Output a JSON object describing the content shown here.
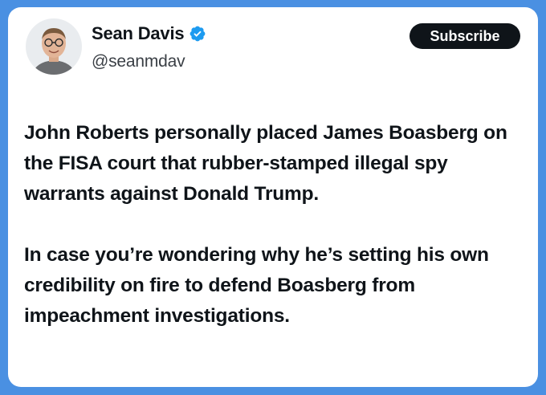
{
  "post": {
    "author": {
      "name": "Sean Davis",
      "handle": "@seanmdav",
      "verified_icon": "verified-badge-icon"
    },
    "subscribe_label": "Subscribe",
    "paragraphs": [
      "John Roberts personally placed James Boasberg on the FISA court that rubber-stamped illegal spy warrants against Donald Trump.",
      "In case you’re wondering why he’s setting his own credibility on fire to defend Boasberg from impeachment investigations."
    ]
  },
  "colors": {
    "background": "#4a90e2",
    "card": "#ffffff",
    "text": "#0f1419",
    "verified": "#1d9bf0",
    "button": "#0f1419"
  }
}
